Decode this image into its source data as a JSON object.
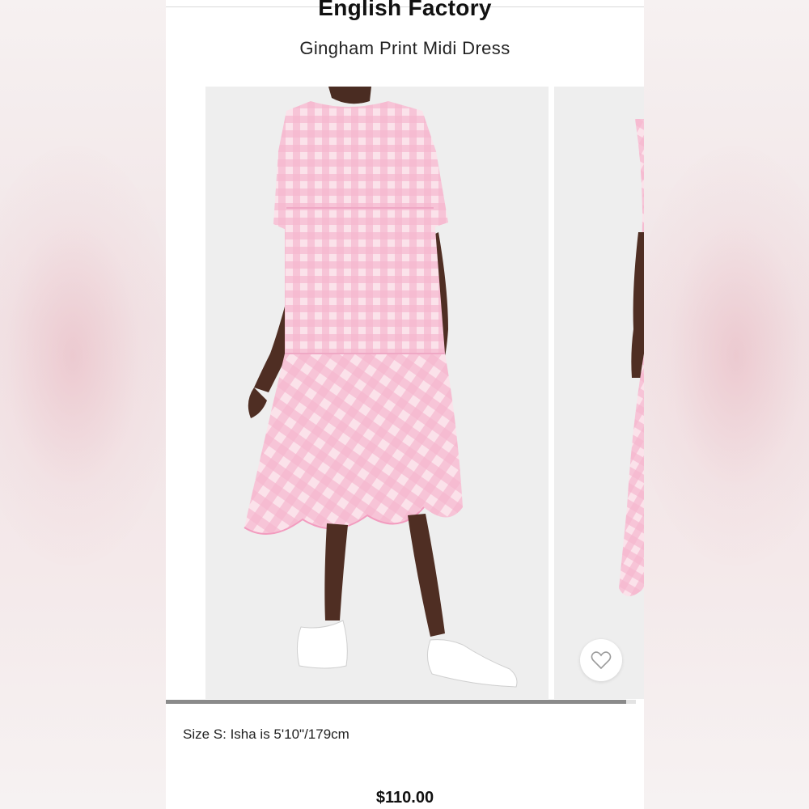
{
  "product": {
    "brand": "English Factory",
    "name": "Gingham Print Midi Dress",
    "size_note": "Size S: Isha is 5'10\"/179cm",
    "price": "$110.00"
  },
  "gallery": {
    "photos": [
      {
        "subject": "model in pink gingham midi dress, front view"
      },
      {
        "subject": "model in pink gingham midi dress, side view (partially visible)"
      }
    ],
    "progress": 0.98
  },
  "icons": {
    "wishlist": "heart-outline-icon"
  },
  "colors": {
    "gingham_pink": "#f6b8cf",
    "gingham_light": "#fbe2ea",
    "photo_background": "#eeeeee",
    "progress_fill": "#8a8a8a"
  }
}
